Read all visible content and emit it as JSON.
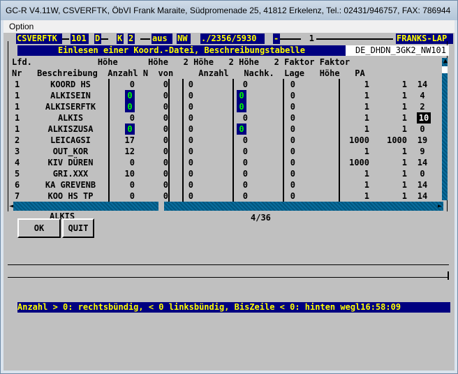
{
  "window": {
    "title": "GC-R V4.11W, CSVERFTK, ÖbVI Frank Maraite, Südpromenade 25, 41812 Erkelenz, Tel.: 02431/946757, FAX: 786944"
  },
  "menu": {
    "items": [
      "Option"
    ]
  },
  "header": {
    "fields": [
      "CSVERFTK",
      "101",
      "D",
      "K",
      "2",
      "aus",
      "NW",
      "./2356/5930",
      "-",
      "1",
      "FRANKS-LAP"
    ]
  },
  "banner": {
    "title": "Einlesen einer Koord.-Datei, Beschreibungstabelle",
    "database": "DE_DHDN_3GK2_NW101"
  },
  "table": {
    "header_row1": "Lfd.             Höhe      Höhe   2 Höhe   2 Höhe   2 Faktor Faktor",
    "header_row2": "Nr   Beschreibung  Anzahl N  von     Anzahl   Nachk.  Lage   Höhe   PA",
    "rows": [
      {
        "nr": "1",
        "desc": "KOORD HS",
        "anzahl": "0",
        "n": "0",
        "von": "0",
        "anz2": "0",
        "nachk": "0",
        "lage": "1",
        "hoehe": "1",
        "pa": "14"
      },
      {
        "nr": "1",
        "desc": "ALKISEIN",
        "anzahl": "0",
        "n": "0",
        "von": "0",
        "anz2": "0",
        "nachk": "0",
        "lage": "1",
        "hoehe": "1",
        "pa": "4"
      },
      {
        "nr": "1",
        "desc": "ALKISERFTK",
        "anzahl": "0",
        "n": "0",
        "von": "0",
        "anz2": "0",
        "nachk": "0",
        "lage": "1",
        "hoehe": "1",
        "pa": "2"
      },
      {
        "nr": "1",
        "desc": "ALKIS",
        "anzahl": "0",
        "n": "0",
        "von": "0",
        "anz2": "0",
        "nachk": "0",
        "lage": "1",
        "hoehe": "1",
        "pa": "10"
      },
      {
        "nr": "1",
        "desc": "ALKISZUSA",
        "anzahl": "0",
        "n": "0",
        "von": "0",
        "anz2": "0",
        "nachk": "0",
        "lage": "1",
        "hoehe": "1",
        "pa": "0"
      },
      {
        "nr": "2",
        "desc": "LEICAGSI",
        "anzahl": "17",
        "n": "0",
        "von": "0",
        "anz2": "0",
        "nachk": "0",
        "lage": "1000",
        "hoehe": "1000",
        "pa": "19"
      },
      {
        "nr": "3",
        "desc": "OUT_KOR",
        "anzahl": "12",
        "n": "0",
        "von": "0",
        "anz2": "0",
        "nachk": "0",
        "lage": "1",
        "hoehe": "1",
        "pa": "9"
      },
      {
        "nr": "4",
        "desc": "KIV DÜREN",
        "anzahl": "0",
        "n": "0",
        "von": "0",
        "anz2": "0",
        "nachk": "0",
        "lage": "1000",
        "hoehe": "1",
        "pa": "14"
      },
      {
        "nr": "5",
        "desc": "GRI.XXX",
        "anzahl": "10",
        "n": "0",
        "von": "0",
        "anz2": "0",
        "nachk": "0",
        "lage": "1",
        "hoehe": "1",
        "pa": "0"
      },
      {
        "nr": "6",
        "desc": "KA GREVENB",
        "anzahl": "0",
        "n": "0",
        "von": "0",
        "anz2": "0",
        "nachk": "0",
        "lage": "1",
        "hoehe": "1",
        "pa": "14"
      },
      {
        "nr": "7",
        "desc": "KOO HS TP",
        "anzahl": "0",
        "n": "0",
        "von": "0",
        "anz2": "0",
        "nachk": "0",
        "lage": "1",
        "hoehe": "1",
        "pa": "14"
      }
    ]
  },
  "buttons": {
    "group_label": "ALKIS",
    "ok": "OK",
    "quit": "QUIT"
  },
  "pagination": {
    "text": "4/36"
  },
  "status": {
    "text": "Anzahl > 0: rechtsbündig, < 0 linksbündig, BisZeile < 0: hinten wegl16:58:09"
  },
  "colors": {
    "field_bg": "#000080",
    "field_text": "#ffff00",
    "selected_text": "#00ff00",
    "client_bg": "#c0c0c0"
  }
}
